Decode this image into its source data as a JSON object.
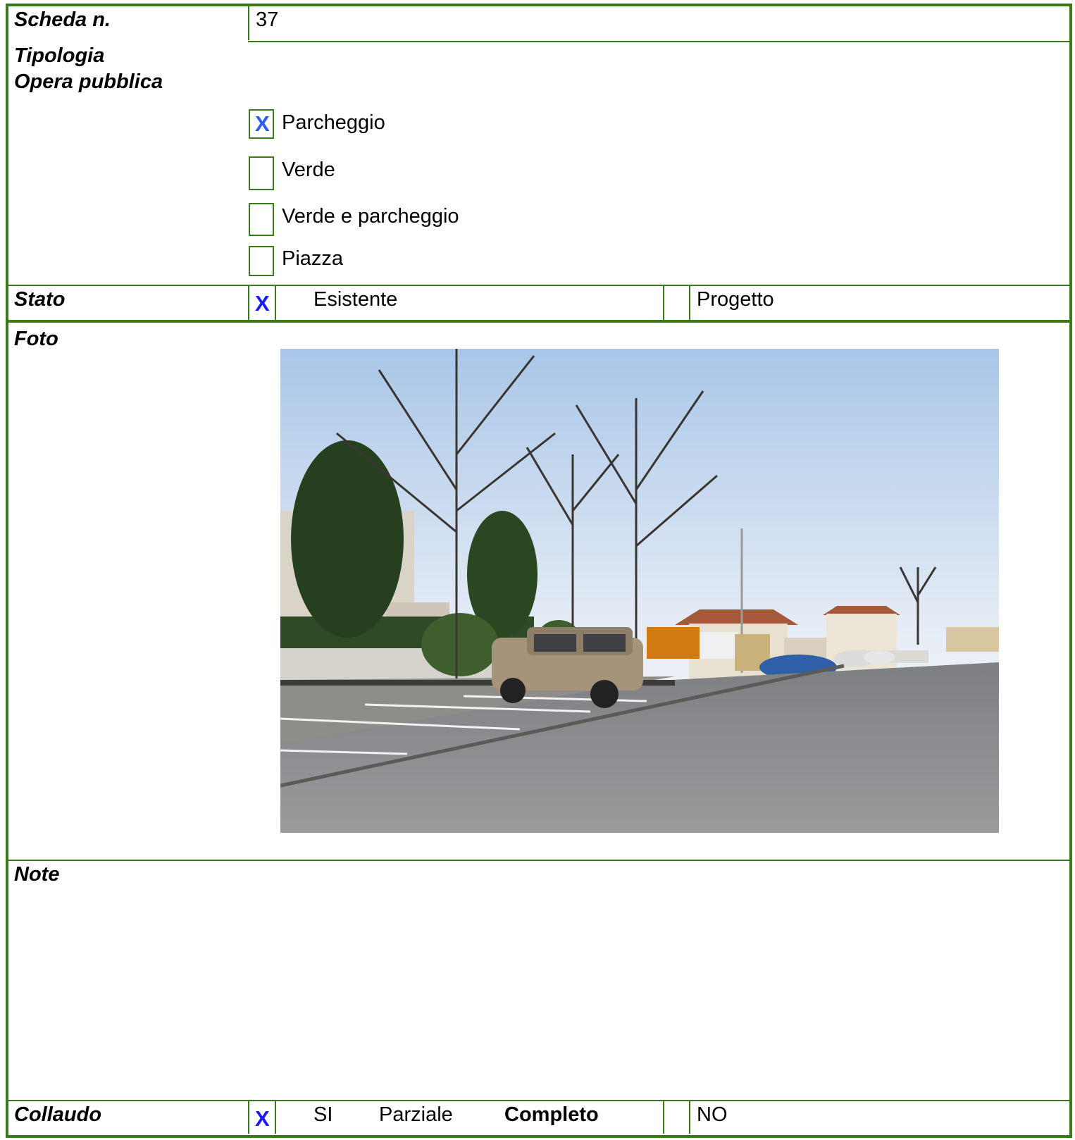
{
  "scheda": {
    "label": "Scheda n.",
    "value": "37"
  },
  "tipologia": {
    "label_line1": "Tipologia",
    "label_line2": "Opera pubblica",
    "options": [
      {
        "label": "Parcheggio",
        "checked": true,
        "mark": "X"
      },
      {
        "label": "Verde",
        "checked": false,
        "mark": ""
      },
      {
        "label": "Verde e parcheggio",
        "checked": false,
        "mark": ""
      },
      {
        "label": "Piazza",
        "checked": false,
        "mark": ""
      }
    ]
  },
  "stato": {
    "label": "Stato",
    "mark": "X",
    "esistente": "Esistente",
    "progetto": "Progetto"
  },
  "foto": {
    "label": "Foto"
  },
  "note": {
    "label": "Note"
  },
  "collaudo": {
    "label": "Collaudo",
    "mark": "X",
    "si": "SI",
    "parziale": "Parziale",
    "completo": "Completo",
    "no": "NO"
  },
  "colors": {
    "border": "#3a7a1a",
    "check_mark": "#2e5bff"
  }
}
